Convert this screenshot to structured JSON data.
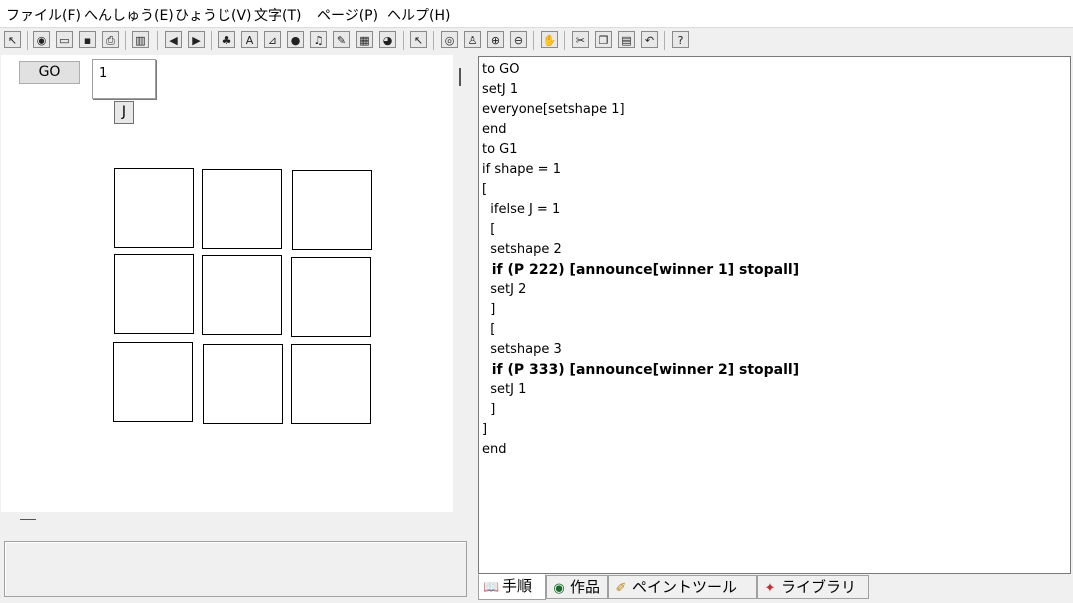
{
  "menu": [
    "ファイル(F)",
    "へんしゅう(E)",
    "ひょうじ(V)",
    "文字(T)",
    "ページ(P)",
    "ヘルプ(H)"
  ],
  "toolbar": [
    {
      "icon": "pointer-arrow-icon",
      "glyph": "↖"
    },
    {
      "icon": "globe-icon",
      "glyph": "◉"
    },
    {
      "icon": "open-folder-icon",
      "glyph": "▭"
    },
    {
      "icon": "save-disk-icon",
      "glyph": "▪"
    },
    {
      "icon": "print-icon",
      "glyph": "⎙"
    },
    {
      "icon": "columns-icon",
      "glyph": "▥"
    },
    {
      "icon": "back-arrow-icon",
      "glyph": "◀"
    },
    {
      "icon": "forward-arrow-icon",
      "glyph": "▶"
    },
    {
      "icon": "turtle-icon",
      "glyph": "♣"
    },
    {
      "icon": "text-box-icon",
      "glyph": "A"
    },
    {
      "icon": "slider-icon",
      "glyph": "⊿"
    },
    {
      "icon": "button-icon",
      "glyph": "●"
    },
    {
      "icon": "music-icon",
      "glyph": "♫"
    },
    {
      "icon": "pencil-icon",
      "glyph": "✎"
    },
    {
      "icon": "movie-icon",
      "glyph": "▦"
    },
    {
      "icon": "video-icon",
      "glyph": "◕"
    },
    {
      "icon": "select-cursor-icon",
      "glyph": "↖"
    },
    {
      "icon": "eye-icon",
      "glyph": "◎"
    },
    {
      "icon": "stamp-icon",
      "glyph": "♙"
    },
    {
      "icon": "zoom-in-icon",
      "glyph": "⊕"
    },
    {
      "icon": "zoom-out-icon",
      "glyph": "⊖"
    },
    {
      "icon": "stop-hand-icon",
      "glyph": "✋"
    },
    {
      "icon": "cut-scissors-icon",
      "glyph": "✂"
    },
    {
      "icon": "copy-icon",
      "glyph": "❐"
    },
    {
      "icon": "paste-icon",
      "glyph": "▤"
    },
    {
      "icon": "undo-icon",
      "glyph": "↶"
    },
    {
      "icon": "help-icon",
      "glyph": "?"
    }
  ],
  "stage": {
    "go_label": "GO",
    "text_box_value": "1",
    "j_label": "J"
  },
  "code": [
    "to GO",
    "setJ 1",
    "everyone[setshape 1]",
    "end",
    "to G1",
    "if shape = 1",
    "[",
    "  ifelse J = 1",
    "  [",
    "  setshape 2",
    "  if (P 222) [announce[winner 1] stopall]",
    "  setJ 2",
    "  ]",
    "  [",
    "  setshape 3",
    "  if (P 333) [announce[winner 2] stopall]",
    "  setJ 1",
    "  ]",
    "]",
    "end"
  ],
  "tabs": [
    {
      "label": "手順",
      "icon": "procedures-book-icon",
      "glyph": "📖"
    },
    {
      "label": "作品",
      "icon": "project-globe-icon",
      "glyph": "◉"
    },
    {
      "label": "ペイントツール",
      "icon": "paint-brush-icon",
      "glyph": "✐"
    },
    {
      "label": "ライブラリ",
      "icon": "library-shapes-icon",
      "glyph": "✦"
    }
  ]
}
